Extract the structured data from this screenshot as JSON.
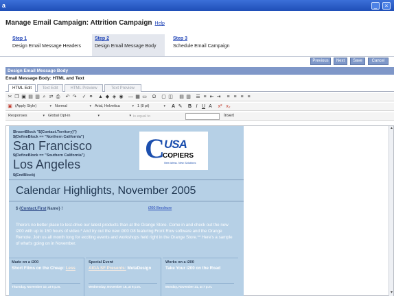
{
  "window": {
    "app_icon": "a",
    "controls": [
      "_",
      "×"
    ]
  },
  "page": {
    "title": "Manage Email Campaign: Attrition Campaign",
    "help_link": "Help"
  },
  "steps": [
    {
      "num": "Step 1",
      "label": "Design Email Message Headers",
      "active": false
    },
    {
      "num": "Step 2",
      "label": "Design Email Message Body",
      "active": true
    },
    {
      "num": "Step 3",
      "label": "Schedule Email Campaign",
      "active": false
    }
  ],
  "actions": {
    "previous": "Previous",
    "next": "Next",
    "save": "Save",
    "cancel": "Cancel"
  },
  "section": {
    "header": "Design Email Message Body",
    "subheader": "Email Message Body: HTML and Text"
  },
  "tabs": [
    "HTML Edit",
    "Text Edit",
    "HTML Preview",
    "Text Preview"
  ],
  "toolbar2": {
    "style": "(Apply Style)",
    "format": "Normal",
    "font": "Arial, Helvetica",
    "size": "1 (8 pt)"
  },
  "toolbar3": {
    "field": "Responses",
    "list": "Global Opt-in",
    "operator": "is equal to",
    "insert": "Insert"
  },
  "newsletter": {
    "tags": {
      "insert_block": "$InsertBlock \"$(Contact.Territory)\"}",
      "define_block_north": "$(DefineBlock == \"Northern California\")",
      "define_block_south": "$(DefineBlock == \"Southern California\")",
      "end_block": "$(EndBlock)"
    },
    "city_north": "San Francisco",
    "city_south": "Los Angeles",
    "logo": {
      "c": "C",
      "usa": "USA",
      "copiers": "COPIERS",
      "tagline": "New ideas. New Solutions"
    },
    "calendar_title": "Calendar Highlights, November 2005",
    "greeting_prefix": "$ {",
    "greeting_field": "Contact.First",
    "greeting_suffix": " Name} !",
    "brochure_link": "i200 Brochure",
    "intro_text": "There's no better place to test-drive our latest products than at the Orange Store. Come in and check out the new i200 with up to 150 hours of video.* And try out the new i300 G8 featuring Front Row software and the Orange Remote. Join us all month long for exciting events and workshops held right in the Orange Store.** Here's a sample of what's going on in November.",
    "events": [
      {
        "label": "Made on a i200",
        "title_a": "Short Films on the Cheap: ",
        "title_link": "Less",
        "title_b": "",
        "date": "Thursday, November 10, at 6 p.m."
      },
      {
        "label": "Special Event",
        "title_a": "",
        "title_link": "AIGA SF Presents:",
        "title_b": " MetaDesign",
        "date": "Wednesday, November 16, at 6 p.m."
      },
      {
        "label": "Works on a i200",
        "title_a": "Take Your i200 on the Road",
        "title_link": "",
        "title_b": "",
        "date": "Monday, November 21, at 7 p.m."
      }
    ]
  },
  "colors": {
    "titlebar": "#1f4fb8",
    "section": "#7f97c8",
    "newsletter_bg": "#b6d0e6",
    "logo_blue": "#1c4fae"
  }
}
